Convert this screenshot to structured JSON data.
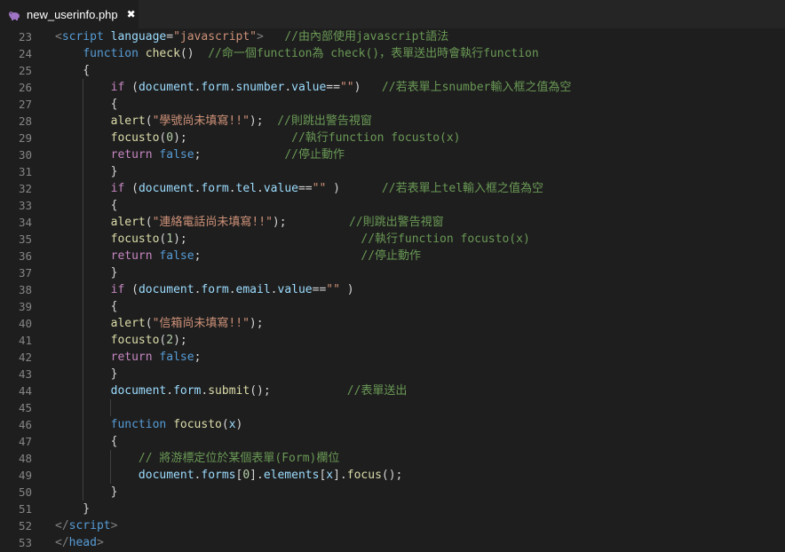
{
  "tab": {
    "title": "new_userinfo.php",
    "close": "✖"
  },
  "lines": [
    {
      "n": "23",
      "t": [
        [
          "<",
          "p"
        ],
        [
          "script",
          "t"
        ],
        [
          " ",
          "w"
        ],
        [
          "language",
          "a"
        ],
        [
          "=",
          "w"
        ],
        [
          "\"javascript\"",
          "s"
        ],
        [
          ">",
          "p"
        ],
        [
          "   ",
          "w"
        ],
        [
          "//由內部使用javascript語法",
          "m"
        ]
      ]
    },
    {
      "n": "24",
      "t": [
        [
          "    ",
          "w"
        ],
        [
          "function",
          "k"
        ],
        [
          " ",
          "w"
        ],
        [
          "check",
          "f"
        ],
        [
          "()  ",
          "w"
        ],
        [
          "//命一個function為 check()，表單送出時會執行function",
          "m"
        ]
      ]
    },
    {
      "n": "25",
      "t": [
        [
          "    {",
          "w"
        ]
      ]
    },
    {
      "n": "26",
      "t": [
        [
          "        ",
          "w"
        ],
        [
          "if",
          "c"
        ],
        [
          " (",
          "w"
        ],
        [
          "document",
          "v"
        ],
        [
          ".",
          "w"
        ],
        [
          "form",
          "v"
        ],
        [
          ".",
          "w"
        ],
        [
          "snumber",
          "v"
        ],
        [
          ".",
          "w"
        ],
        [
          "value",
          "v"
        ],
        [
          "==",
          "w"
        ],
        [
          "\"\"",
          "s"
        ],
        [
          ")   ",
          "w"
        ],
        [
          "//若表單上snumber輸入框之值為空",
          "m"
        ]
      ]
    },
    {
      "n": "27",
      "t": [
        [
          "        {",
          "w"
        ]
      ]
    },
    {
      "n": "28",
      "t": [
        [
          "        ",
          "w"
        ],
        [
          "alert",
          "f"
        ],
        [
          "(",
          "w"
        ],
        [
          "\"學號尚未填寫!!\"",
          "s"
        ],
        [
          ");  ",
          "w"
        ],
        [
          "//則跳出警告視窗",
          "m"
        ]
      ]
    },
    {
      "n": "29",
      "t": [
        [
          "        ",
          "w"
        ],
        [
          "focusto",
          "f"
        ],
        [
          "(",
          "w"
        ],
        [
          "0",
          "n"
        ],
        [
          ");               ",
          "w"
        ],
        [
          "//執行function focusto(x)",
          "m"
        ]
      ]
    },
    {
      "n": "30",
      "t": [
        [
          "        ",
          "w"
        ],
        [
          "return",
          "c"
        ],
        [
          " ",
          "w"
        ],
        [
          "false",
          "k"
        ],
        [
          ";            ",
          "w"
        ],
        [
          "//停止動作",
          "m"
        ]
      ]
    },
    {
      "n": "31",
      "t": [
        [
          "        }",
          "w"
        ]
      ]
    },
    {
      "n": "32",
      "t": [
        [
          "        ",
          "w"
        ],
        [
          "if",
          "c"
        ],
        [
          " (",
          "w"
        ],
        [
          "document",
          "v"
        ],
        [
          ".",
          "w"
        ],
        [
          "form",
          "v"
        ],
        [
          ".",
          "w"
        ],
        [
          "tel",
          "v"
        ],
        [
          ".",
          "w"
        ],
        [
          "value",
          "v"
        ],
        [
          "==",
          "w"
        ],
        [
          "\"\"",
          "s"
        ],
        [
          " )      ",
          "w"
        ],
        [
          "//若表單上tel輸入框之值為空",
          "m"
        ]
      ]
    },
    {
      "n": "33",
      "t": [
        [
          "        {",
          "w"
        ]
      ]
    },
    {
      "n": "34",
      "t": [
        [
          "        ",
          "w"
        ],
        [
          "alert",
          "f"
        ],
        [
          "(",
          "w"
        ],
        [
          "\"連絡電話尚未填寫!!\"",
          "s"
        ],
        [
          ");         ",
          "w"
        ],
        [
          "//則跳出警告視窗",
          "m"
        ]
      ]
    },
    {
      "n": "35",
      "t": [
        [
          "        ",
          "w"
        ],
        [
          "focusto",
          "f"
        ],
        [
          "(",
          "w"
        ],
        [
          "1",
          "n"
        ],
        [
          ");                         ",
          "w"
        ],
        [
          "//執行function focusto(x)",
          "m"
        ]
      ]
    },
    {
      "n": "36",
      "t": [
        [
          "        ",
          "w"
        ],
        [
          "return",
          "c"
        ],
        [
          " ",
          "w"
        ],
        [
          "false",
          "k"
        ],
        [
          ";                       ",
          "w"
        ],
        [
          "//停止動作",
          "m"
        ]
      ]
    },
    {
      "n": "37",
      "t": [
        [
          "        }",
          "w"
        ]
      ]
    },
    {
      "n": "38",
      "t": [
        [
          "        ",
          "w"
        ],
        [
          "if",
          "c"
        ],
        [
          " (",
          "w"
        ],
        [
          "document",
          "v"
        ],
        [
          ".",
          "w"
        ],
        [
          "form",
          "v"
        ],
        [
          ".",
          "w"
        ],
        [
          "email",
          "v"
        ],
        [
          ".",
          "w"
        ],
        [
          "value",
          "v"
        ],
        [
          "==",
          "w"
        ],
        [
          "\"\"",
          "s"
        ],
        [
          " )",
          "w"
        ]
      ]
    },
    {
      "n": "39",
      "t": [
        [
          "        {",
          "w"
        ]
      ]
    },
    {
      "n": "40",
      "t": [
        [
          "        ",
          "w"
        ],
        [
          "alert",
          "f"
        ],
        [
          "(",
          "w"
        ],
        [
          "\"信箱尚未填寫!!\"",
          "s"
        ],
        [
          ");",
          "w"
        ]
      ]
    },
    {
      "n": "41",
      "t": [
        [
          "        ",
          "w"
        ],
        [
          "focusto",
          "f"
        ],
        [
          "(",
          "w"
        ],
        [
          "2",
          "n"
        ],
        [
          ");",
          "w"
        ]
      ]
    },
    {
      "n": "42",
      "t": [
        [
          "        ",
          "w"
        ],
        [
          "return",
          "c"
        ],
        [
          " ",
          "w"
        ],
        [
          "false",
          "k"
        ],
        [
          ";",
          "w"
        ]
      ]
    },
    {
      "n": "43",
      "t": [
        [
          "        }",
          "w"
        ]
      ]
    },
    {
      "n": "44",
      "t": [
        [
          "        ",
          "w"
        ],
        [
          "document",
          "v"
        ],
        [
          ".",
          "w"
        ],
        [
          "form",
          "v"
        ],
        [
          ".",
          "w"
        ],
        [
          "submit",
          "f"
        ],
        [
          "();           ",
          "w"
        ],
        [
          "//表單送出",
          "m"
        ]
      ]
    },
    {
      "n": "45",
      "t": []
    },
    {
      "n": "46",
      "t": [
        [
          "        ",
          "w"
        ],
        [
          "function",
          "k"
        ],
        [
          " ",
          "w"
        ],
        [
          "focusto",
          "f"
        ],
        [
          "(",
          "w"
        ],
        [
          "x",
          "v"
        ],
        [
          ")",
          "w"
        ]
      ]
    },
    {
      "n": "47",
      "t": [
        [
          "        {",
          "w"
        ]
      ]
    },
    {
      "n": "48",
      "t": [
        [
          "            ",
          "w"
        ],
        [
          "// 將游標定位於某個表單(Form)欄位",
          "m"
        ]
      ]
    },
    {
      "n": "49",
      "t": [
        [
          "            ",
          "w"
        ],
        [
          "document",
          "v"
        ],
        [
          ".",
          "w"
        ],
        [
          "forms",
          "v"
        ],
        [
          "[",
          "w"
        ],
        [
          "0",
          "n"
        ],
        [
          "].",
          "w"
        ],
        [
          "elements",
          "v"
        ],
        [
          "[",
          "w"
        ],
        [
          "x",
          "v"
        ],
        [
          "].",
          "w"
        ],
        [
          "focus",
          "f"
        ],
        [
          "();",
          "w"
        ]
      ]
    },
    {
      "n": "50",
      "t": [
        [
          "        }",
          "w"
        ]
      ]
    },
    {
      "n": "51",
      "t": [
        [
          "    }",
          "w"
        ]
      ]
    },
    {
      "n": "52",
      "t": [
        [
          "</",
          "p"
        ],
        [
          "script",
          "t"
        ],
        [
          ">",
          "p"
        ]
      ]
    },
    {
      "n": "53",
      "t": [
        [
          "</",
          "p"
        ],
        [
          "head",
          "t"
        ],
        [
          ">",
          "p"
        ]
      ]
    }
  ]
}
